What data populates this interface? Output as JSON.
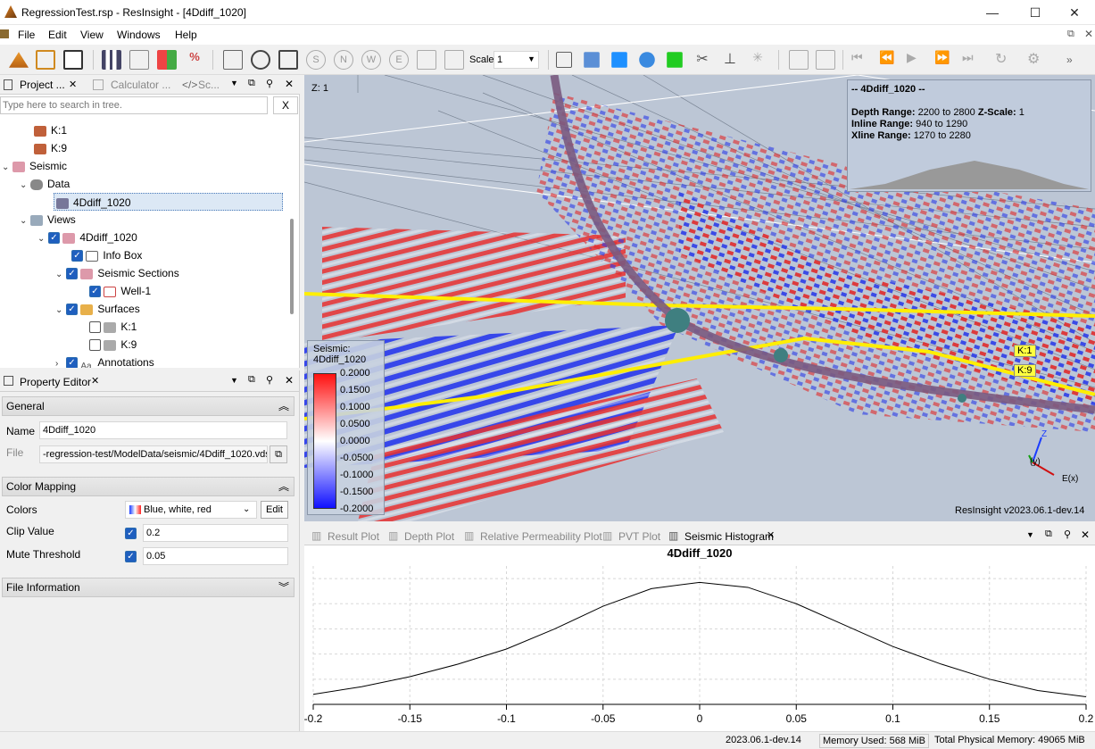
{
  "window": {
    "title": "RegressionTest.rsp - ResInsight - [4Ddiff_1020]",
    "min": "—",
    "max": "☐",
    "close": "✕"
  },
  "menu": [
    "File",
    "Edit",
    "View",
    "Windows",
    "Help"
  ],
  "toolbar": {
    "scale_label": "Scale",
    "scale_value": "1"
  },
  "project_panel": {
    "tabs": [
      "Project ...",
      "Calculator ...",
      "Sc..."
    ],
    "search_placeholder": "Type here to search in tree.",
    "clear": "X",
    "tree": [
      {
        "label": "K:1"
      },
      {
        "label": "K:9"
      },
      {
        "label": "Seismic"
      },
      {
        "label": "Data"
      },
      {
        "label": "4Ddiff_1020"
      },
      {
        "label": "Views"
      },
      {
        "label": "4Ddiff_1020"
      },
      {
        "label": "Info Box"
      },
      {
        "label": "Seismic Sections"
      },
      {
        "label": "Well-1"
      },
      {
        "label": "Surfaces"
      },
      {
        "label": "K:1"
      },
      {
        "label": "K:9"
      },
      {
        "label": "Annotations"
      }
    ]
  },
  "property_editor": {
    "tab": "Property Editor",
    "groups": {
      "general": "General",
      "color_mapping": "Color Mapping",
      "file_info": "File Information"
    },
    "name_label": "Name",
    "name_value": "4Ddiff_1020",
    "file_label": "File",
    "file_value": "-regression-test/ModelData/seismic/4Ddiff_1020.vds",
    "colors_label": "Colors",
    "colors_value": "Blue, white, red",
    "edit": "Edit",
    "clip_label": "Clip Value",
    "clip_value": "0.2",
    "mute_label": "Mute Threshold",
    "mute_value": "0.05"
  },
  "view3d": {
    "zlabel": "Z: 1",
    "info_title": "-- 4Ddiff_1020 --",
    "depth_label": "Depth Range:",
    "depth_value": "2200 to 2800",
    "zscale_label": "Z-Scale:",
    "zscale_value": "1",
    "inline_label": "Inline Range:",
    "inline_value": "940 to 1290",
    "xline_label": "Xline Range:",
    "xline_value": "1270 to 2280",
    "legend_title": "Seismic:",
    "legend_name": "4Ddiff_1020",
    "legend_ticks": [
      "0.2000",
      "0.1500",
      "0.1000",
      "0.0500",
      "0.0000",
      "-0.0500",
      "-0.1000",
      "-0.1500",
      "-0.2000"
    ],
    "k1": "K:1",
    "k9": "K:9",
    "axis_z": "Z",
    "axis_y": "(y)",
    "axis_x": "E(x)",
    "version": "ResInsight v2023.06.1-dev.14"
  },
  "plot_tabs": [
    "Result Plot",
    "Depth Plot",
    "Relative Permeability Plot",
    "PVT Plot",
    "Seismic Histogram"
  ],
  "chart_data": {
    "type": "line",
    "title": "4Ddiff_1020",
    "xlim": [
      -0.2,
      0.2
    ],
    "ylim": [
      0,
      1.1
    ],
    "grid": true,
    "xticks": [
      "-0.2",
      "-0.15",
      "-0.1",
      "-0.05",
      "0",
      "0.05",
      "0.1",
      "0.15",
      "0.2"
    ],
    "x": [
      -0.2,
      -0.175,
      -0.15,
      -0.125,
      -0.1,
      -0.075,
      -0.05,
      -0.025,
      0,
      0.025,
      0.05,
      0.075,
      0.1,
      0.125,
      0.15,
      0.175,
      0.2
    ],
    "y": [
      0.08,
      0.14,
      0.22,
      0.32,
      0.44,
      0.6,
      0.78,
      0.92,
      0.97,
      0.93,
      0.8,
      0.63,
      0.46,
      0.32,
      0.2,
      0.11,
      0.06
    ]
  },
  "status": {
    "version": "2023.06.1-dev.14",
    "memory_used": "Memory Used: 568 MiB",
    "total_memory": "Total Physical Memory: 49065 MiB"
  }
}
